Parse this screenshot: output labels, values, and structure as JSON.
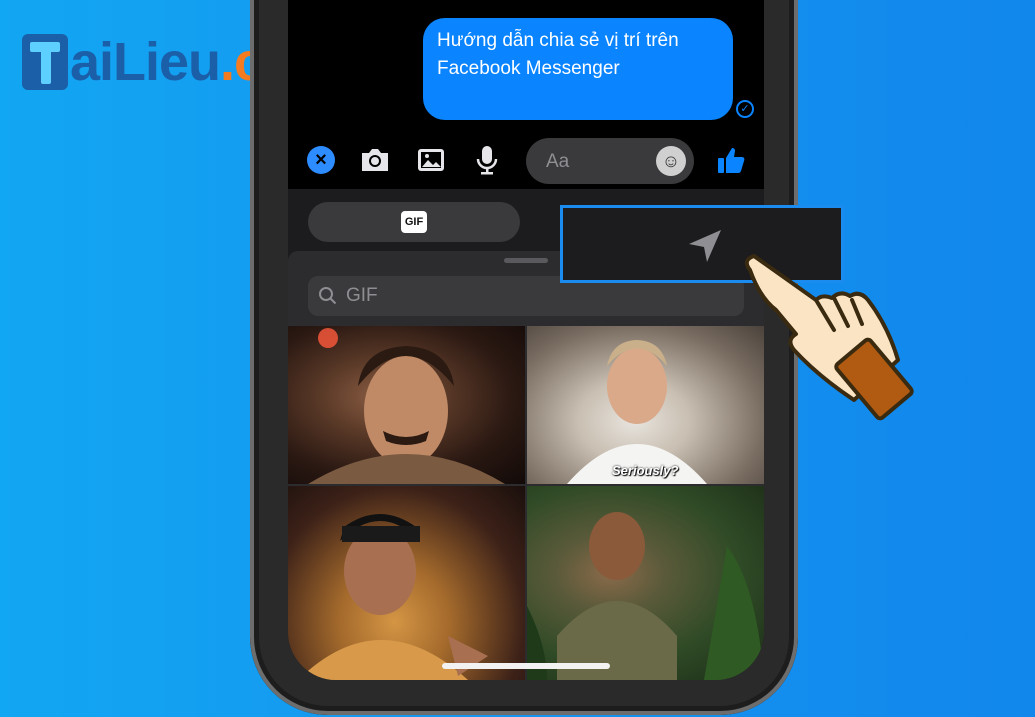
{
  "logo": {
    "part1": "aiLieu",
    "part2": ".com"
  },
  "message": {
    "line1": "Hướng dẫn chia sẻ vị trí trên",
    "line2": "Facebook Messenger",
    "status_icon": "check-circle-icon"
  },
  "composer": {
    "placeholder": "Aa",
    "icons": [
      "close-icon",
      "camera-icon",
      "photo-icon",
      "microphone-icon",
      "emoji-icon",
      "thumbs-up-icon"
    ]
  },
  "tabs": {
    "gif_label": "GIF",
    "location_icon": "location-arrow-icon"
  },
  "search": {
    "placeholder": "GIF"
  },
  "gifs": {
    "caption_2": "Seriously?"
  },
  "colors": {
    "accent": "#0a84ff",
    "highlight": "#1a8cf0",
    "background": "#1595f0",
    "logo_blue": "#1b5fa8",
    "logo_orange": "#f47b20"
  }
}
